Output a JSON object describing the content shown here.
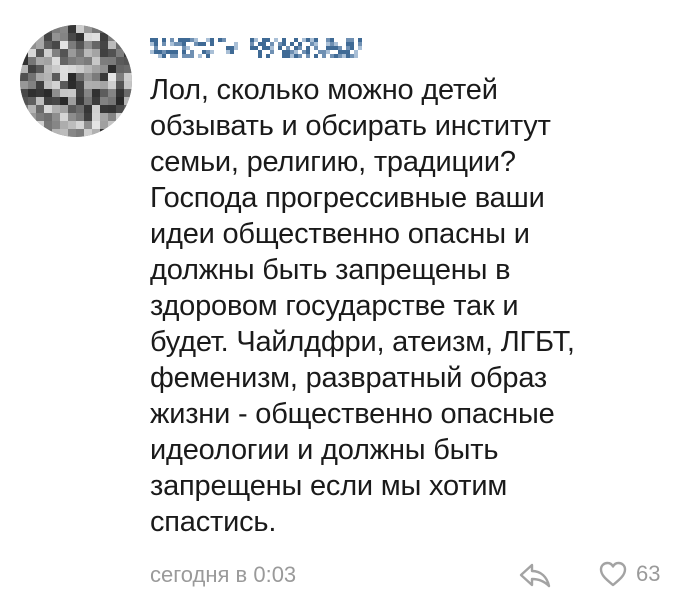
{
  "comment": {
    "author": {
      "display": "pixelated (name obscured)"
    },
    "text": "Лол, сколько можно детей\nобзывать и обсирать институт\nсемьи, религию, традиции?\nГоспода прогрессивные ваши\nидеи общественно опасны и\nдолжны быть запрещены в\nздоровом государстве так и\nбудет. Чайлдфри, атеизм, ЛГБТ,\nфеменизм, развратный образ\nжизни - общественно опасные\nидеологии и должны быть\nзапрещены если мы хотим\nспастись.",
    "timestamp": "сегодня в 0:03",
    "likes": "63",
    "icons": {
      "reply": "reply-arrow-icon",
      "like": "heart-outline-icon"
    }
  },
  "colors": {
    "text": "#1a1a1a",
    "muted": "#9a9a9a",
    "author": "#5a7b9e",
    "icon": "#a3a3a3"
  }
}
